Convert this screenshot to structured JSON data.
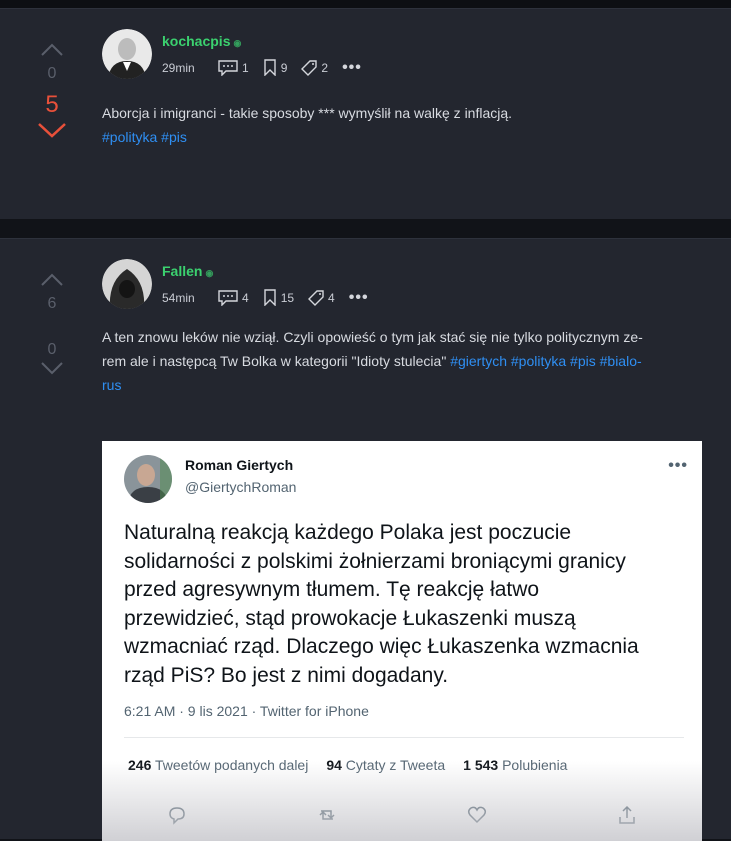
{
  "posts": [
    {
      "votes_up_count": "0",
      "score": "5",
      "author": "kochacpis",
      "time": "29min",
      "comments": "1",
      "bookmarks": "9",
      "tags_count": "2",
      "text": "Aborcja i imigranci - takie sposoby *** wymyślił na walkę z inflacją.",
      "tags": [
        "#polityka",
        "#pis"
      ]
    },
    {
      "votes_up_count": "6",
      "votes_down_count": "0",
      "author": "Fallen",
      "time": "54min",
      "comments": "4",
      "bookmarks": "15",
      "tags_count": "4",
      "text_line1": "A ten znowu leków nie wziął. Czyli opowieść o tym jak stać się nie tylko politycznym ze-",
      "text_line2_prefix": "rem ale i następcą Tw Bolka w kategorii \"Idioty stulecia\"",
      "tags_line2": [
        "#giertych",
        "#polityka",
        "#pis",
        "#bialo-"
      ],
      "tags_line3": "rus"
    }
  ],
  "tweet": {
    "name": "Roman Giertych",
    "handle": "@GiertychRoman",
    "more": "•••",
    "lines": [
      "Naturalną reakcją każdego Polaka jest poczucie",
      "solidarności z polskimi żołnierzami broniącymi granicy",
      "przed agresywnym tłumem. Tę reakcję łatwo",
      "przewidzieć, stąd prowokacje Łukaszenki muszą",
      "wzmacniać rząd. Dlaczego więc Łukaszenka wzmacnia",
      "rząd PiS? Bo jest z nimi dogadany."
    ],
    "timestamp": "6:21 AM · 9 lis 2021 · Twitter for iPhone",
    "stats": [
      {
        "num": "246",
        "label": "Tweetów podanych dalej"
      },
      {
        "num": "94",
        "label": "Cytaty z Tweeta"
      },
      {
        "num": "1 543",
        "label": "Polubienia"
      }
    ]
  },
  "colors": {
    "accent_green": "#3bd16f",
    "tag_blue": "#2f8ff3",
    "score_red": "#e8503a"
  }
}
